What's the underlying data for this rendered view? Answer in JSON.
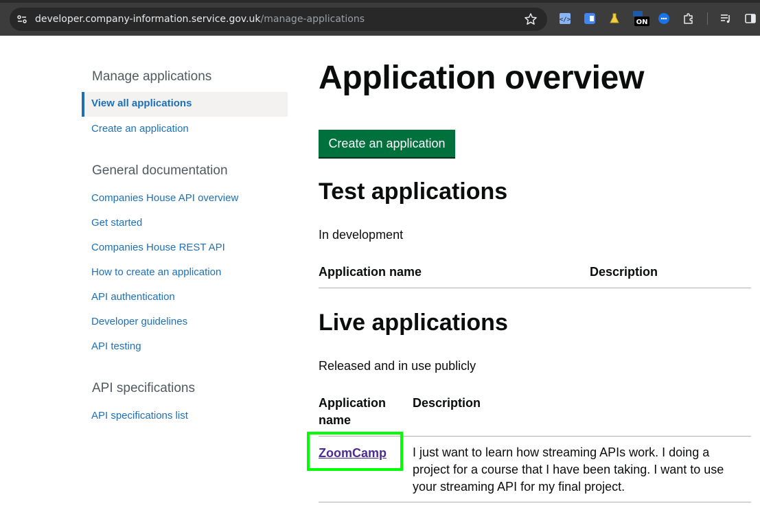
{
  "browser": {
    "url_host": "developer.company-information.service.gov.uk",
    "url_path": "/manage-applications",
    "extension_badge": "ON"
  },
  "sidebar": {
    "manage_heading": "Manage applications",
    "manage_links": [
      "View all applications",
      "Create an application"
    ],
    "docs_heading": "General documentation",
    "docs_links": [
      "Companies House API overview",
      "Get started",
      "Companies House REST API",
      "How to create an application",
      "API authentication",
      "Developer guidelines",
      "API testing"
    ],
    "specs_heading": "API specifications",
    "specs_links": [
      "API specifications list"
    ]
  },
  "main": {
    "title": "Application overview",
    "create_button": "Create an application",
    "test": {
      "heading": "Test applications",
      "caption": "In development",
      "columns": [
        "Application name",
        "Description"
      ]
    },
    "live": {
      "heading": "Live applications",
      "caption": "Released and in use publicly",
      "columns": [
        "Application name",
        "Description"
      ],
      "rows": [
        {
          "name": "ZoomCamp",
          "description": "I just want to learn how streaming APIs work. I doing a project for a course that I have been taking. I want to use your streaming API for my final project."
        }
      ]
    }
  },
  "colors": {
    "link": "#1d70b8",
    "visited_link": "#4c2c92",
    "button_green": "#00703c",
    "highlight": "#00ff00"
  }
}
